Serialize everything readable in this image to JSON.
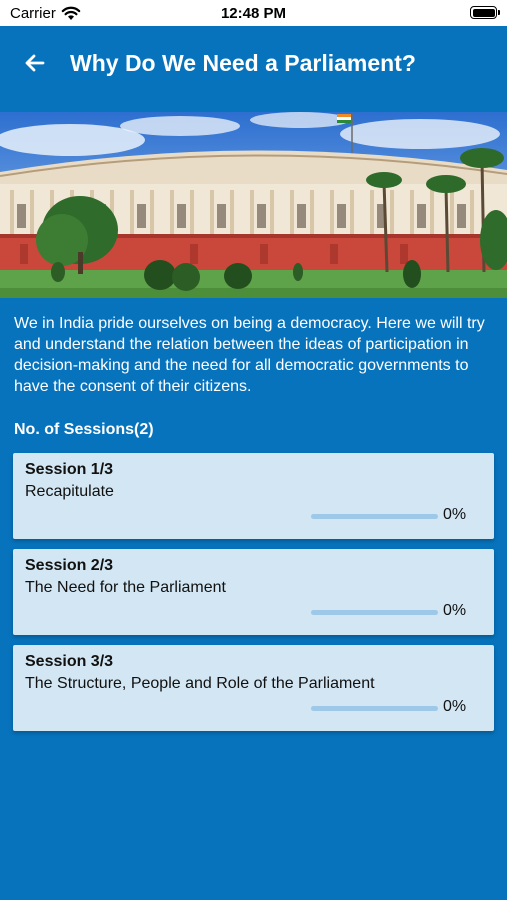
{
  "status_bar": {
    "carrier": "Carrier",
    "time": "12:48 PM"
  },
  "header": {
    "title": "Why Do We Need a Parliament?"
  },
  "intro": {
    "text": "We in India pride ourselves on being a democracy. Here we will try and understand the relation between the ideas of participation in decision-making and the need for all democratic governments to have the consent of their citizens."
  },
  "sessions_heading": "No. of Sessions(2)",
  "sessions": [
    {
      "title": "Session 1/3",
      "subtitle": "Recapitulate",
      "progress_label": "0%",
      "progress": 0
    },
    {
      "title": "Session 2/3",
      "subtitle": "The Need for the Parliament",
      "progress_label": "0%",
      "progress": 0
    },
    {
      "title": "Session 3/3",
      "subtitle": "The Structure, People and Role of the Parliament",
      "progress_label": "0%",
      "progress": 0
    }
  ],
  "colors": {
    "background": "#0773bd",
    "card": "#d3e6f3",
    "progress_track": "#9ec8e8"
  },
  "icons": {
    "back": "arrow-left-icon",
    "wifi": "wifi-icon",
    "battery": "battery-icon"
  }
}
